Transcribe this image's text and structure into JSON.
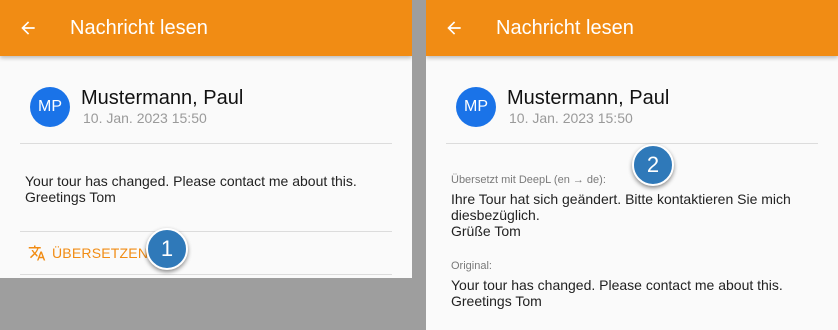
{
  "colors": {
    "appbar": "#f18c14",
    "avatar": "#1a73e8",
    "marker": "#2f79b9"
  },
  "left": {
    "appbar": {
      "back_icon": "arrow-left-icon",
      "title": "Nachricht lesen"
    },
    "sender": {
      "initials": "MP",
      "name": "Mustermann, Paul",
      "date": "10. Jan. 2023 15:50"
    },
    "message": {
      "text": "Your tour has changed. Please contact me about this.\nGreetings Tom"
    },
    "translate_button": {
      "icon": "translate-icon",
      "label": "ÜBERSETZEN"
    },
    "marker": "1"
  },
  "right": {
    "appbar": {
      "back_icon": "arrow-left-icon",
      "title": "Nachricht lesen"
    },
    "sender": {
      "initials": "MP",
      "name": "Mustermann, Paul",
      "date": "10. Jan. 2023 15:50"
    },
    "translated": {
      "caption": "Übersetzt mit DeepL (en → de):",
      "text": "Ihre Tour hat sich geändert. Bitte kontaktieren Sie mich diesbezüglich.\nGrüße Tom"
    },
    "original": {
      "caption": "Original:",
      "text": "Your tour has changed. Please contact me about this.\nGreetings Tom"
    },
    "marker": "2"
  }
}
